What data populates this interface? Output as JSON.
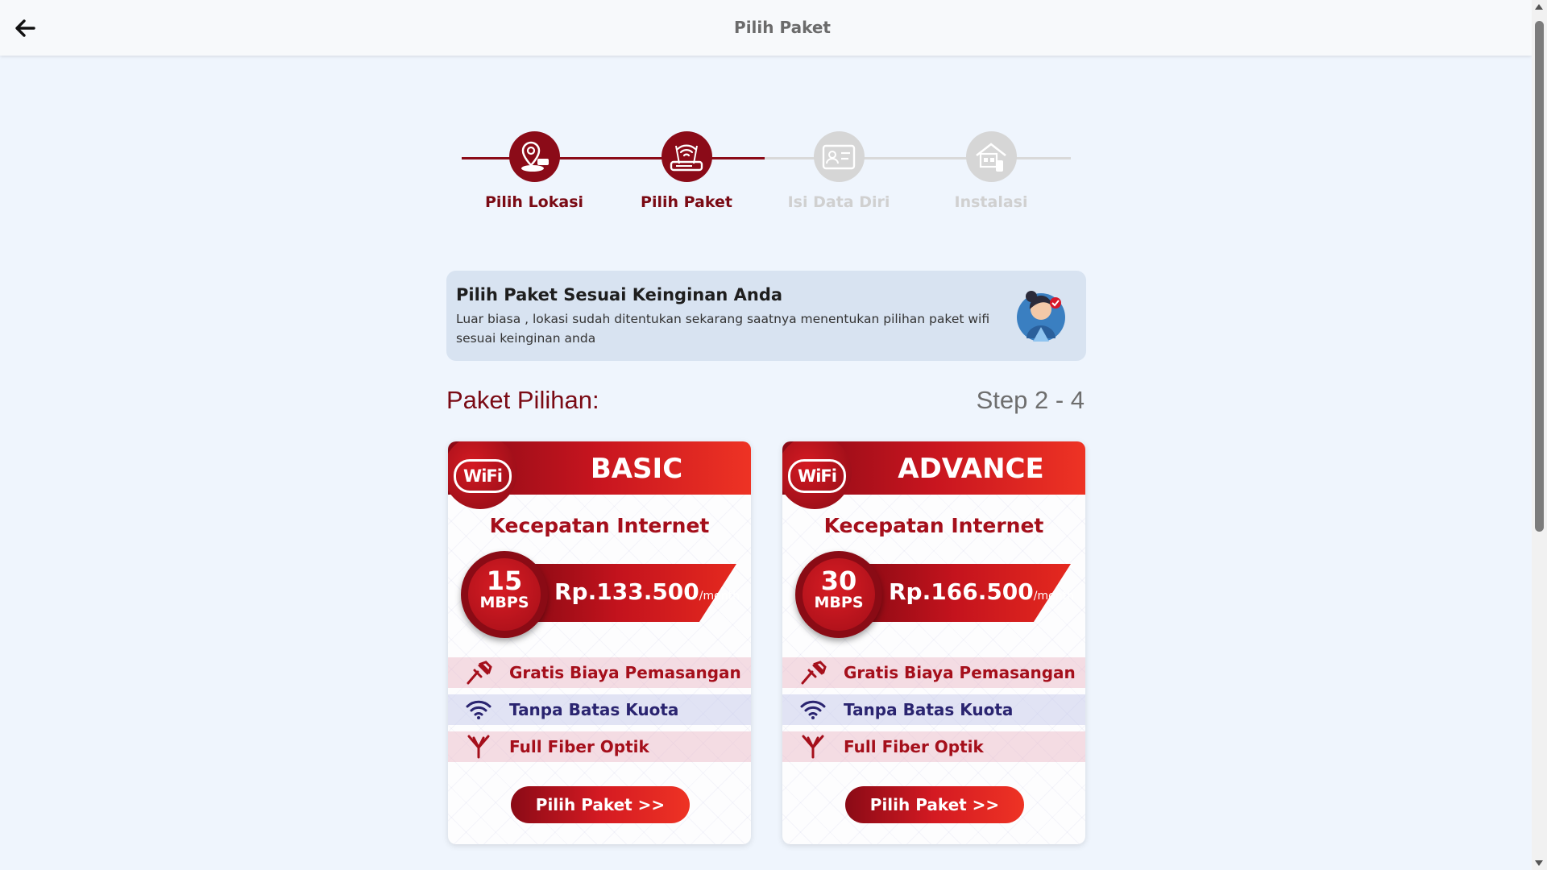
{
  "header": {
    "title": "Pilih Paket",
    "back_icon": "arrow-left-icon"
  },
  "stepper": {
    "steps": [
      {
        "label": "Pilih Lokasi",
        "icon": "location-wifi-icon",
        "state": "done"
      },
      {
        "label": "Pilih Paket",
        "icon": "router-icon",
        "state": "active"
      },
      {
        "label": "Isi Data Diri",
        "icon": "id-card-icon",
        "state": "inactive"
      },
      {
        "label": "Instalasi",
        "icon": "house-install-icon",
        "state": "inactive"
      }
    ]
  },
  "banner": {
    "title": "Pilih Paket Sesuai Keinginan Anda",
    "description": "Luar biasa , lokasi sudah ditentukan sekarang saatnya menentukan pilihan paket wifi sesuai  keinginan anda",
    "avatar": "customer-service-avatar"
  },
  "section": {
    "title": "Paket Pilihan:",
    "step_count": "Step 2 - 4"
  },
  "packages": [
    {
      "name": "BASIC",
      "wifi_label": "WiFi",
      "speed_title": "Kecepatan Internet",
      "speed": "15",
      "speed_unit": "MBPS",
      "price": "Rp.133.500",
      "price_unit": "/month",
      "features": [
        "Gratis Biaya Pemasangan",
        "Tanpa Batas Kuota",
        "Full Fiber Optik"
      ],
      "button": "Pilih Paket >>"
    },
    {
      "name": "ADVANCE",
      "wifi_label": "WiFi",
      "speed_title": "Kecepatan Internet",
      "speed": "30",
      "speed_unit": "MBPS",
      "price": "Rp.166.500",
      "price_unit": "/month",
      "features": [
        "Gratis Biaya Pemasangan",
        "Tanpa Batas Kuota",
        "Full Fiber Optik"
      ],
      "button": "Pilih Paket >>"
    }
  ],
  "colors": {
    "brand": "#8b0b18",
    "accent": "#ee3324",
    "background": "#eff5fd",
    "inactive": "#d6d6d6"
  }
}
